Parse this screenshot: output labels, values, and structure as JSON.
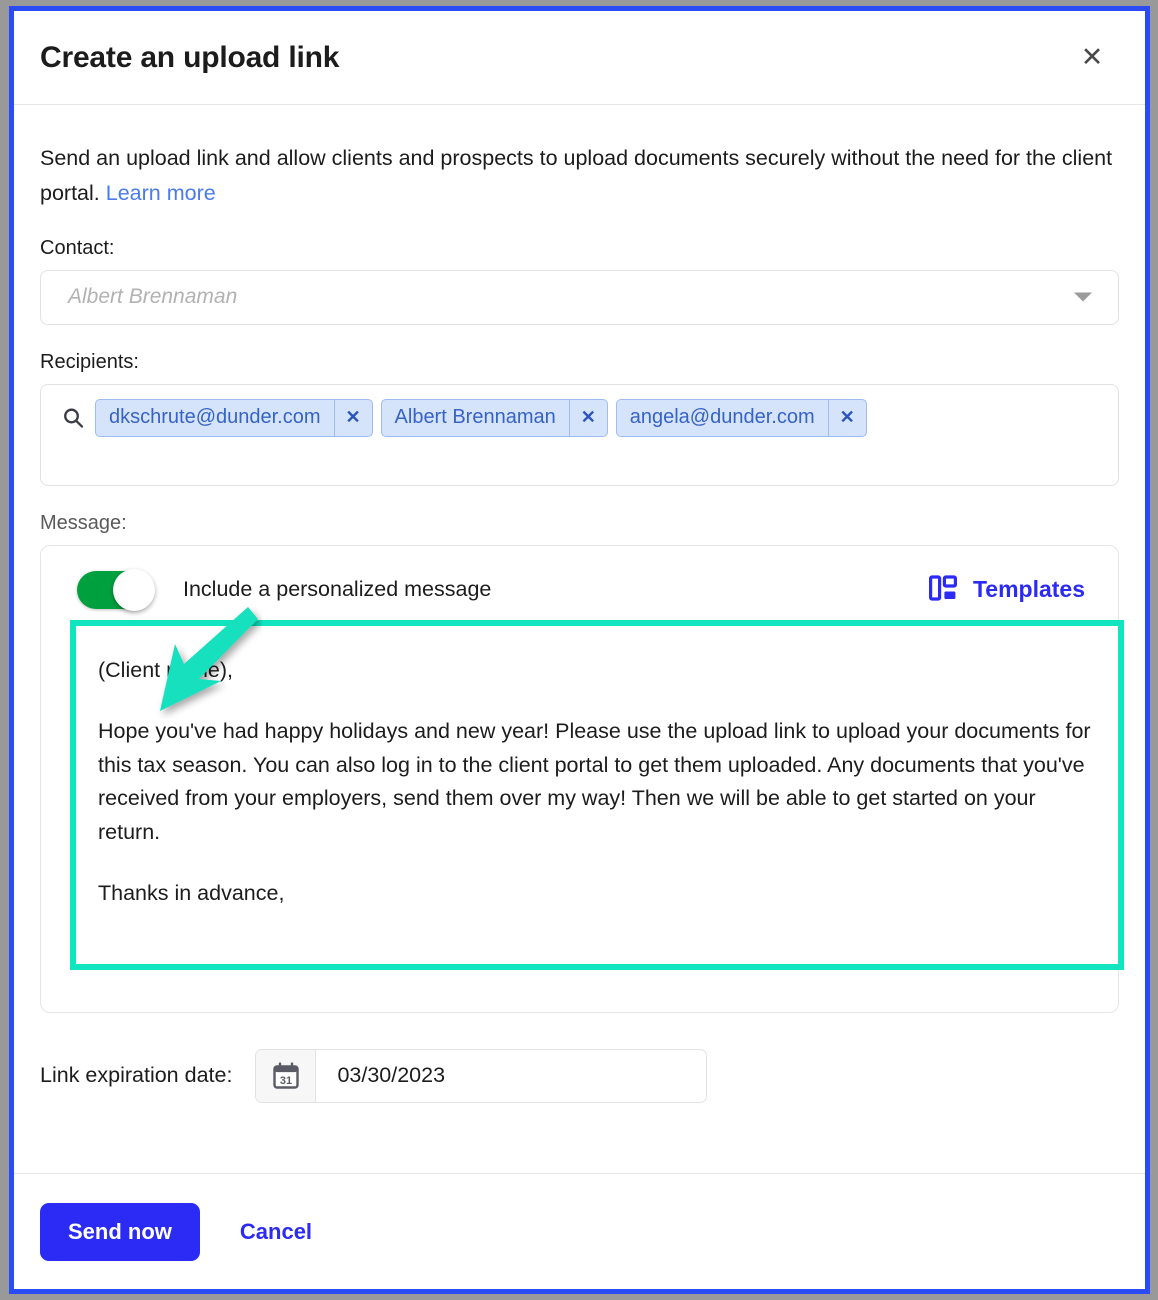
{
  "dialog": {
    "title": "Create an upload link",
    "close_icon": "close-icon",
    "intro": {
      "text": "Send an upload link and allow clients and prospects to upload documents securely without the need for the client portal. ",
      "link_label": "Learn more"
    }
  },
  "contact": {
    "label": "Contact:",
    "placeholder": "Albert Brennaman",
    "value": "",
    "chevron_icon": "chevron-down-icon"
  },
  "recipients": {
    "label": "Recipients:",
    "search_icon": "search-icon",
    "chips": [
      {
        "label": "dkschrute@dunder.com",
        "remove_icon": "✕"
      },
      {
        "label": "Albert Brennaman",
        "remove_icon": "✕"
      },
      {
        "label": "angela@dunder.com",
        "remove_icon": "✕"
      }
    ]
  },
  "message": {
    "label": "Message:",
    "toggle_label": "Include a personalized message",
    "toggle_on": true,
    "templates_label": "Templates",
    "templates_icon": "layout-template-icon",
    "body": {
      "greeting": "(Client name),",
      "paragraph": "Hope you've had happy holidays and new year! Please use the upload link to upload your documents for this tax season. You can also log in to the client portal to get them uploaded. Any documents that you've received from your employers, send them over my way! Then we will be able to get started on your return.",
      "closing": "Thanks in advance,"
    }
  },
  "expiration": {
    "label": "Link expiration date:",
    "calendar_icon": "calendar-icon",
    "calendar_day": "31",
    "date": "03/30/2023"
  },
  "footer": {
    "send_label": "Send now",
    "cancel_label": "Cancel"
  },
  "annotation": {
    "arrow_color": "#14e0bd",
    "highlight_color": "#10e5c0"
  },
  "colors": {
    "accent_blue": "#2b2bf5",
    "link_blue": "#4a7bec",
    "toggle_green": "#00a03e",
    "chip_bg": "#d6e4fb",
    "chip_text": "#3663c6",
    "page_bg": "#999999"
  }
}
